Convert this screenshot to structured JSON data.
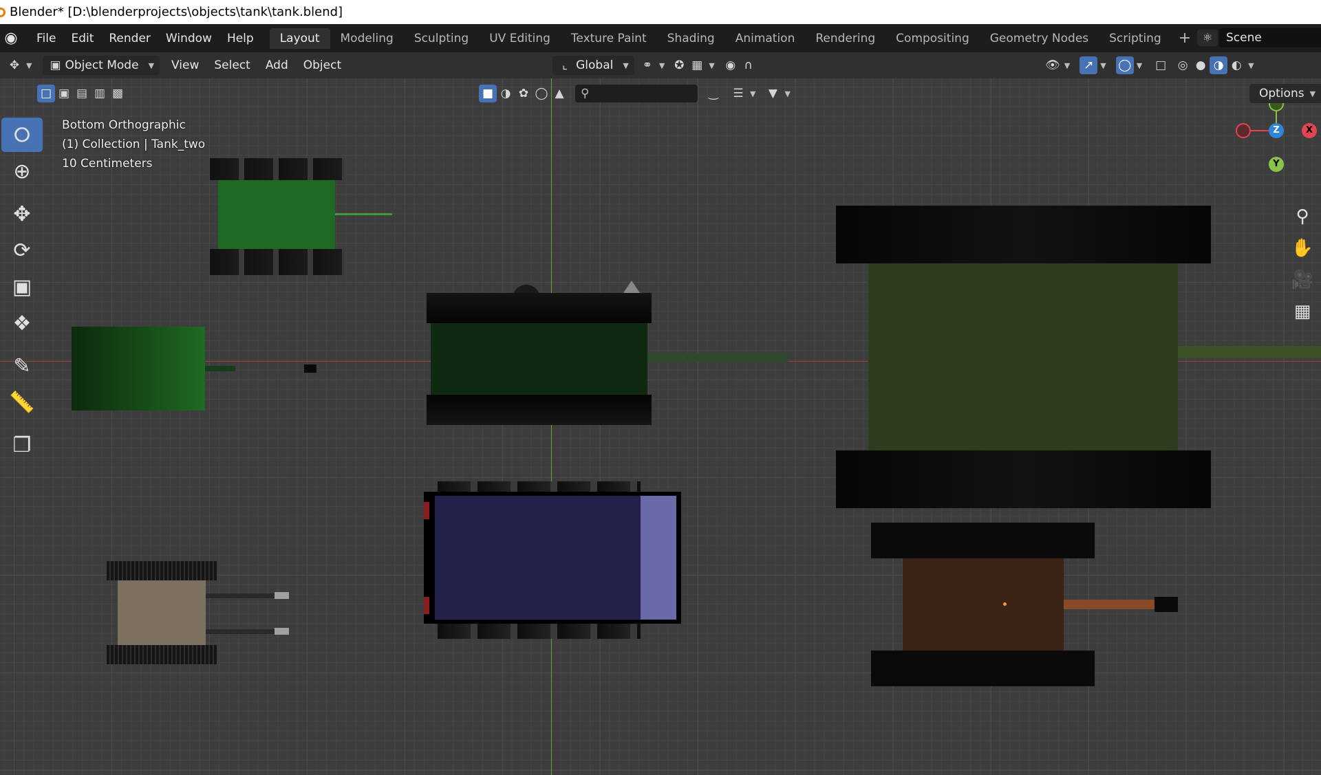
{
  "window_title": "Blender* [D:\\blenderprojects\\objects\\tank\\tank.blend]",
  "menu": [
    "File",
    "Edit",
    "Render",
    "Window",
    "Help"
  ],
  "workspaces": [
    "Layout",
    "Modeling",
    "Sculpting",
    "UV Editing",
    "Texture Paint",
    "Shading",
    "Animation",
    "Rendering",
    "Compositing",
    "Geometry Nodes",
    "Scripting"
  ],
  "active_workspace": "Layout",
  "scene_name": "Scene",
  "header": {
    "mode": "Object Mode",
    "view_menu": "View",
    "select_menu": "Select",
    "add_menu": "Add",
    "object_menu": "Object",
    "transform_orientation": "Global"
  },
  "options_label": "Options",
  "viewport_info": {
    "view_name": "Bottom Orthographic",
    "collection": "(1) Collection | Tank_two",
    "scale": "10 Centimeters"
  },
  "gizmo": {
    "x_label": "X",
    "y_label": "Y",
    "z_label": "Z",
    "x_color": "#e2454f",
    "y_color": "#8bc34a",
    "z_color": "#2f86d8"
  },
  "colors": {
    "accent": "#4772b3",
    "x_axis_line": "#a03c3c",
    "y_axis_line": "#6a9a3a"
  },
  "tools": [
    "select-box",
    "cursor",
    "move",
    "rotate",
    "scale",
    "transform",
    "annotate",
    "measure",
    "add-cube"
  ],
  "nav_icons": [
    "zoom-icon",
    "pan-hand-icon",
    "camera-icon",
    "grid-icon"
  ]
}
